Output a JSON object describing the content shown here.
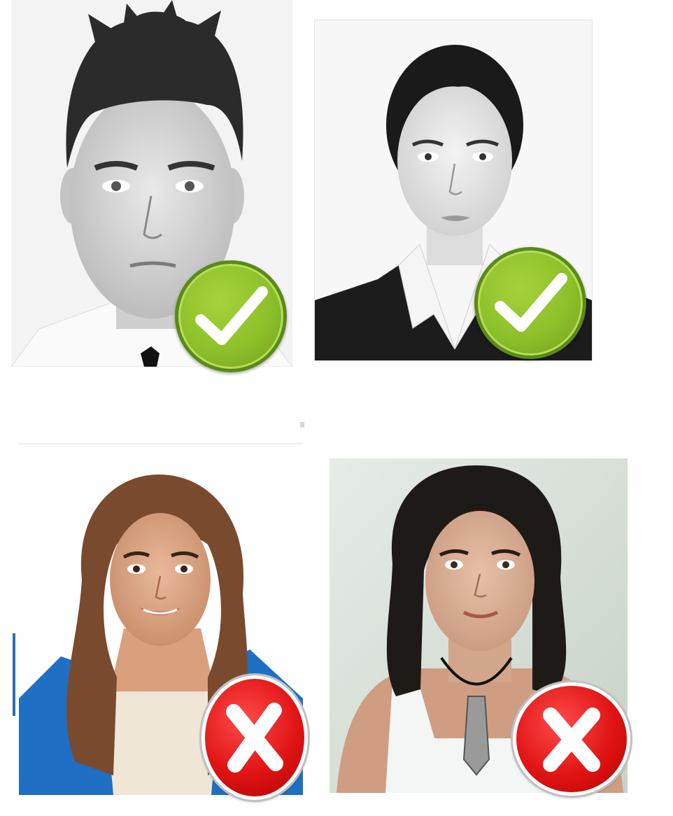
{
  "photos": [
    {
      "subject": "man-portrait",
      "status": "accepted",
      "icon": "checkmark-icon"
    },
    {
      "subject": "woman-portrait-dark-hair",
      "status": "accepted",
      "icon": "checkmark-icon"
    },
    {
      "subject": "woman-portrait-blue-jacket",
      "status": "rejected",
      "icon": "cross-icon"
    },
    {
      "subject": "woman-portrait-necklace",
      "status": "rejected",
      "icon": "cross-icon"
    }
  ],
  "colors": {
    "accept_green": "#8cc02a",
    "reject_red": "#e01414",
    "page_background": "#ffffff"
  }
}
